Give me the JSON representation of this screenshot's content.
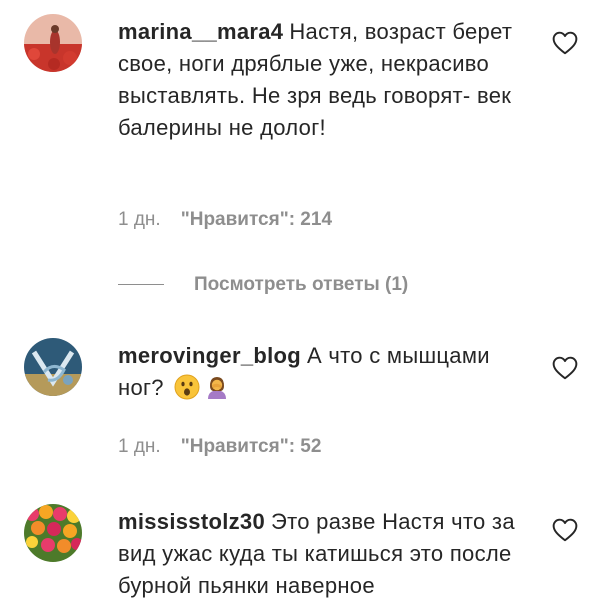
{
  "comments": [
    {
      "username": "marina__mara4",
      "text": "Настя, возраст берет свое, ноги дряблые уже, некрасиво выставлять. Не зря ведь говорят- век балерины не долог!",
      "time": "1 дн.",
      "likes": "\"Нравится\": 214",
      "avatar": "avatar-red-field"
    },
    {
      "username": "merovinger_blog",
      "text": "А что с мышцами ног?",
      "emojis": [
        "astonished-face-icon",
        "person-facepalming-icon"
      ],
      "time": "1 дн.",
      "likes": "\"Нравится\": 52",
      "avatar": "avatar-monogram"
    },
    {
      "username": "mississtolz30",
      "text": "Это разве Настя что за вид ужас куда ты катишься это после бурной пьянки наверное",
      "avatar": "avatar-tulips"
    }
  ],
  "replies": {
    "label": "Посмотреть ответы (1)"
  },
  "icons": {
    "like": "heart-outline-icon"
  },
  "colors": {
    "text": "#262626",
    "secondary": "#8e8e8e",
    "background": "#ffffff"
  }
}
